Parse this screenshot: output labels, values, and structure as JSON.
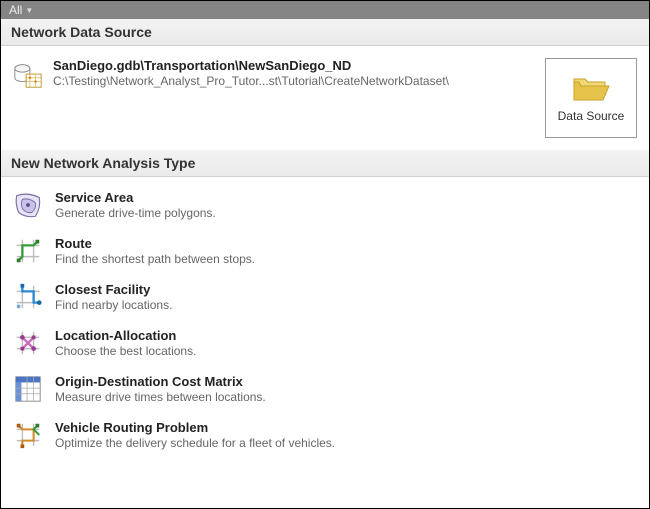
{
  "topbar": {
    "filter_label": "All"
  },
  "sections": {
    "data_source_header": "Network Data Source",
    "analysis_header": "New Network Analysis Type"
  },
  "data_source": {
    "title": "SanDiego.gdb\\Transportation\\NewSanDiego_ND",
    "path": "C:\\Testing\\Network_Analyst_Pro_Tutor...st\\Tutorial\\CreateNetworkDataset\\",
    "button_label": "Data Source"
  },
  "analysis_types": [
    {
      "name": "Service Area",
      "desc": "Generate drive-time polygons.",
      "icon": "service-area"
    },
    {
      "name": "Route",
      "desc": "Find the shortest path between stops.",
      "icon": "route"
    },
    {
      "name": "Closest Facility",
      "desc": "Find nearby locations.",
      "icon": "closest-facility"
    },
    {
      "name": "Location-Allocation",
      "desc": "Choose the best locations.",
      "icon": "location-allocation"
    },
    {
      "name": "Origin-Destination Cost Matrix",
      "desc": "Measure drive times between locations.",
      "icon": "od-matrix"
    },
    {
      "name": "Vehicle Routing Problem",
      "desc": "Optimize the delivery schedule for a fleet of vehicles.",
      "icon": "vrp"
    }
  ]
}
